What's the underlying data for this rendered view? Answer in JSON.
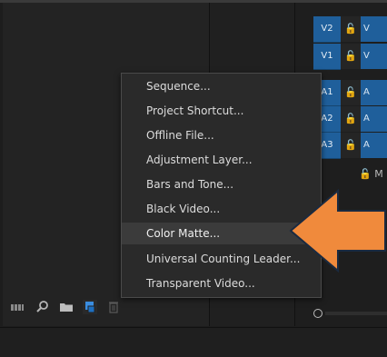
{
  "timeline": {
    "tracks": [
      {
        "label": "V2",
        "lock": "🔓",
        "clip": "V"
      },
      {
        "label": "V1",
        "lock": "🔓",
        "clip": "V"
      },
      {
        "label": "A1",
        "lock": "🔓",
        "clip": "A"
      },
      {
        "label": "A2",
        "lock": "🔓",
        "clip": "A"
      },
      {
        "label": "A3",
        "lock": "🔓",
        "clip": "A"
      }
    ],
    "master_lock": "🔓 M"
  },
  "toolbar": {
    "icons": [
      "list-icon",
      "search-icon",
      "folder-icon",
      "new-item-icon",
      "trash-icon"
    ]
  },
  "context_menu": {
    "items": [
      "Sequence...",
      "Project Shortcut...",
      "Offline File...",
      "Adjustment Layer...",
      "Bars and Tone...",
      "Black Video...",
      "Color Matte...",
      "Universal Counting Leader...",
      "Transparent Video..."
    ],
    "highlighted_index": 6
  },
  "annotation": {
    "arrow_color": "#f08a3c"
  }
}
